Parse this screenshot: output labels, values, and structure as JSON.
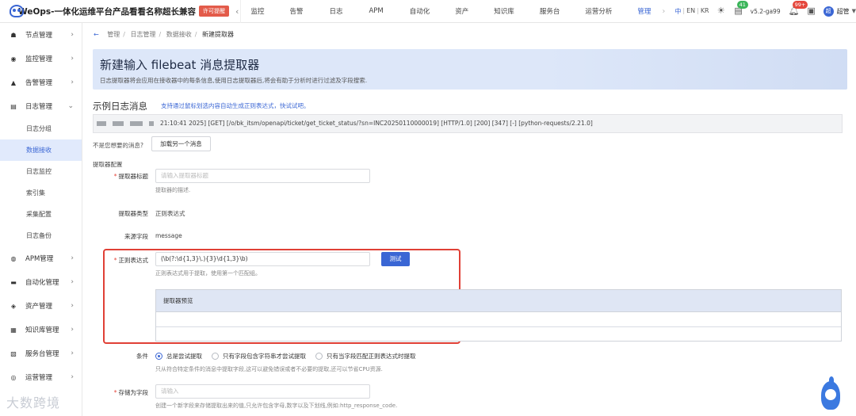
{
  "app": {
    "title": "WeOps-一体化运维平台产品看看名称超长兼容",
    "license_badge": "许可提醒"
  },
  "nav": [
    "监控",
    "告警",
    "日志",
    "APM",
    "自动化",
    "资产",
    "知识库",
    "服务台",
    "运营分析",
    "管理"
  ],
  "lang": {
    "zh": "中",
    "en": "EN",
    "kr": "KR"
  },
  "header": {
    "badge_green": "41",
    "version": "v5.2-ga99",
    "badge_red": "99+",
    "avatar": "超",
    "username": "超管"
  },
  "sidebar": {
    "items": [
      {
        "label": "节点管理"
      },
      {
        "label": "监控管理"
      },
      {
        "label": "告警管理"
      },
      {
        "label": "日志管理"
      },
      {
        "label": "APM管理"
      },
      {
        "label": "自动化管理"
      },
      {
        "label": "资产管理"
      },
      {
        "label": "知识库管理"
      },
      {
        "label": "服务台管理"
      },
      {
        "label": "运营管理"
      }
    ],
    "log_sub": [
      "日志分组",
      "数据接收",
      "日志监控",
      "索引集",
      "采集配置",
      "日志备份"
    ]
  },
  "breadcrumb": {
    "items": [
      "管理",
      "日志管理",
      "数据接收",
      "新建提取器"
    ]
  },
  "hero": {
    "title": "新建输入 filebeat 消息提取器",
    "desc": "日志提取器将会应用在接收器中的每条信息,使用日志提取器后,将会有助于分析时进行过滤及字段搜索."
  },
  "example": {
    "title": "示例日志消息",
    "hint": "支持通过鼠标划选内容自动生成正则表达式，快试试吧。",
    "log_text": "21:10:41 2025] [GET] [/o/bk_itsm/openapi/ticket/get_ticket_status/?sn=INC20250110000019] [HTTP/1.0] [200] [347] [-] [python-requests/2.21.0]",
    "not_wanted": "不是您想要的消息?",
    "load_button": "加载另一个消息"
  },
  "config": {
    "title": "提取器配置",
    "extractor_title_label": "提取器标题",
    "extractor_title_placeholder": "请输入提取器标题",
    "extractor_title_help": "提取器的描述.",
    "type_label": "提取器类型",
    "type_value": "正则表达式",
    "source_label": "来源字段",
    "source_value": "message",
    "regex_label": "正则表达式",
    "regex_value": "(\\b(?:\\d{1,3}\\.){3}\\d{1,3}\\b)",
    "regex_help": "正则表达式用于提取，使用第一个匹配组。",
    "test_button": "测试",
    "preview_title": "提取器预览",
    "condition_label": "条件",
    "conditions": [
      "总是尝试提取",
      "只有字段包含字符串才尝试提取",
      "只有当字段匹配正则表达式时提取"
    ],
    "condition_help": "只从符合特定条件的消息中提取字段,这可以避免错误或者不必要的提取,还可以节省CPU资源.",
    "store_label": "存储为字段",
    "store_placeholder": "请输入",
    "store_help": "创建一个新字段来存储提取出来的值,只允许包含字母,数字以及下划线,例如:http_response_code."
  },
  "footer": {
    "watermark_brand": "大数跨境"
  },
  "colors": {
    "primary": "#3a66d4",
    "highlight_border": "#e04036",
    "hero_bg": "#dde7f9"
  }
}
